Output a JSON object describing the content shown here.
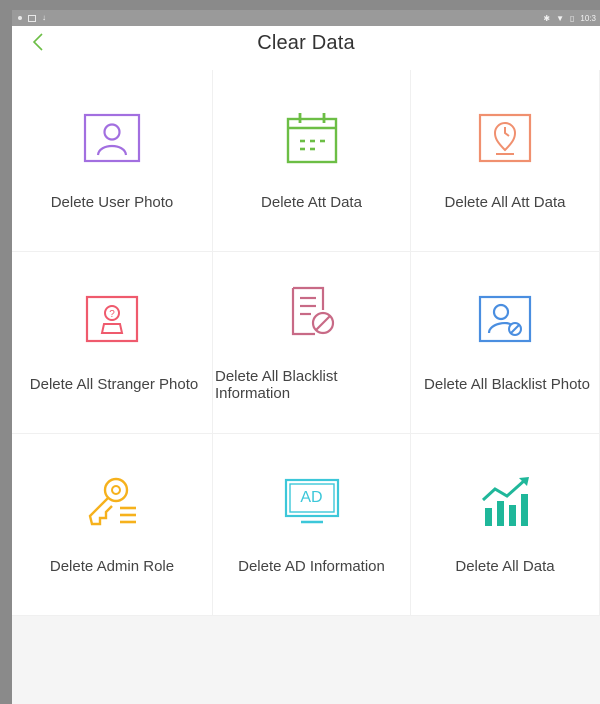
{
  "status": {
    "time": "10:3"
  },
  "header": {
    "title": "Clear Data",
    "back_label": "<"
  },
  "tiles": [
    {
      "label": "Delete User Photo",
      "icon": "user-photo-icon",
      "color": "#a26fe0"
    },
    {
      "label": "Delete Att Data",
      "icon": "calendar-icon",
      "color": "#6cbe45"
    },
    {
      "label": "Delete All Att Data",
      "icon": "location-clock-icon",
      "color": "#f0906f"
    },
    {
      "label": "Delete All Stranger Photo",
      "icon": "stranger-photo-icon",
      "color": "#ef5a6d"
    },
    {
      "label": "Delete All Blacklist Information",
      "icon": "blacklist-doc-icon",
      "color": "#c86a86"
    },
    {
      "label": "Delete All Blacklist Photo",
      "icon": "blacklist-photo-icon",
      "color": "#4a8ee0"
    },
    {
      "label": "Delete Admin Role",
      "icon": "admin-key-icon",
      "color": "#f6b11c"
    },
    {
      "label": "Delete AD Information",
      "icon": "ad-monitor-icon",
      "color": "#3cc7d9",
      "icon_text": "AD"
    },
    {
      "label": "Delete All Data",
      "icon": "chart-growth-icon",
      "color": "#1fb79a"
    }
  ]
}
